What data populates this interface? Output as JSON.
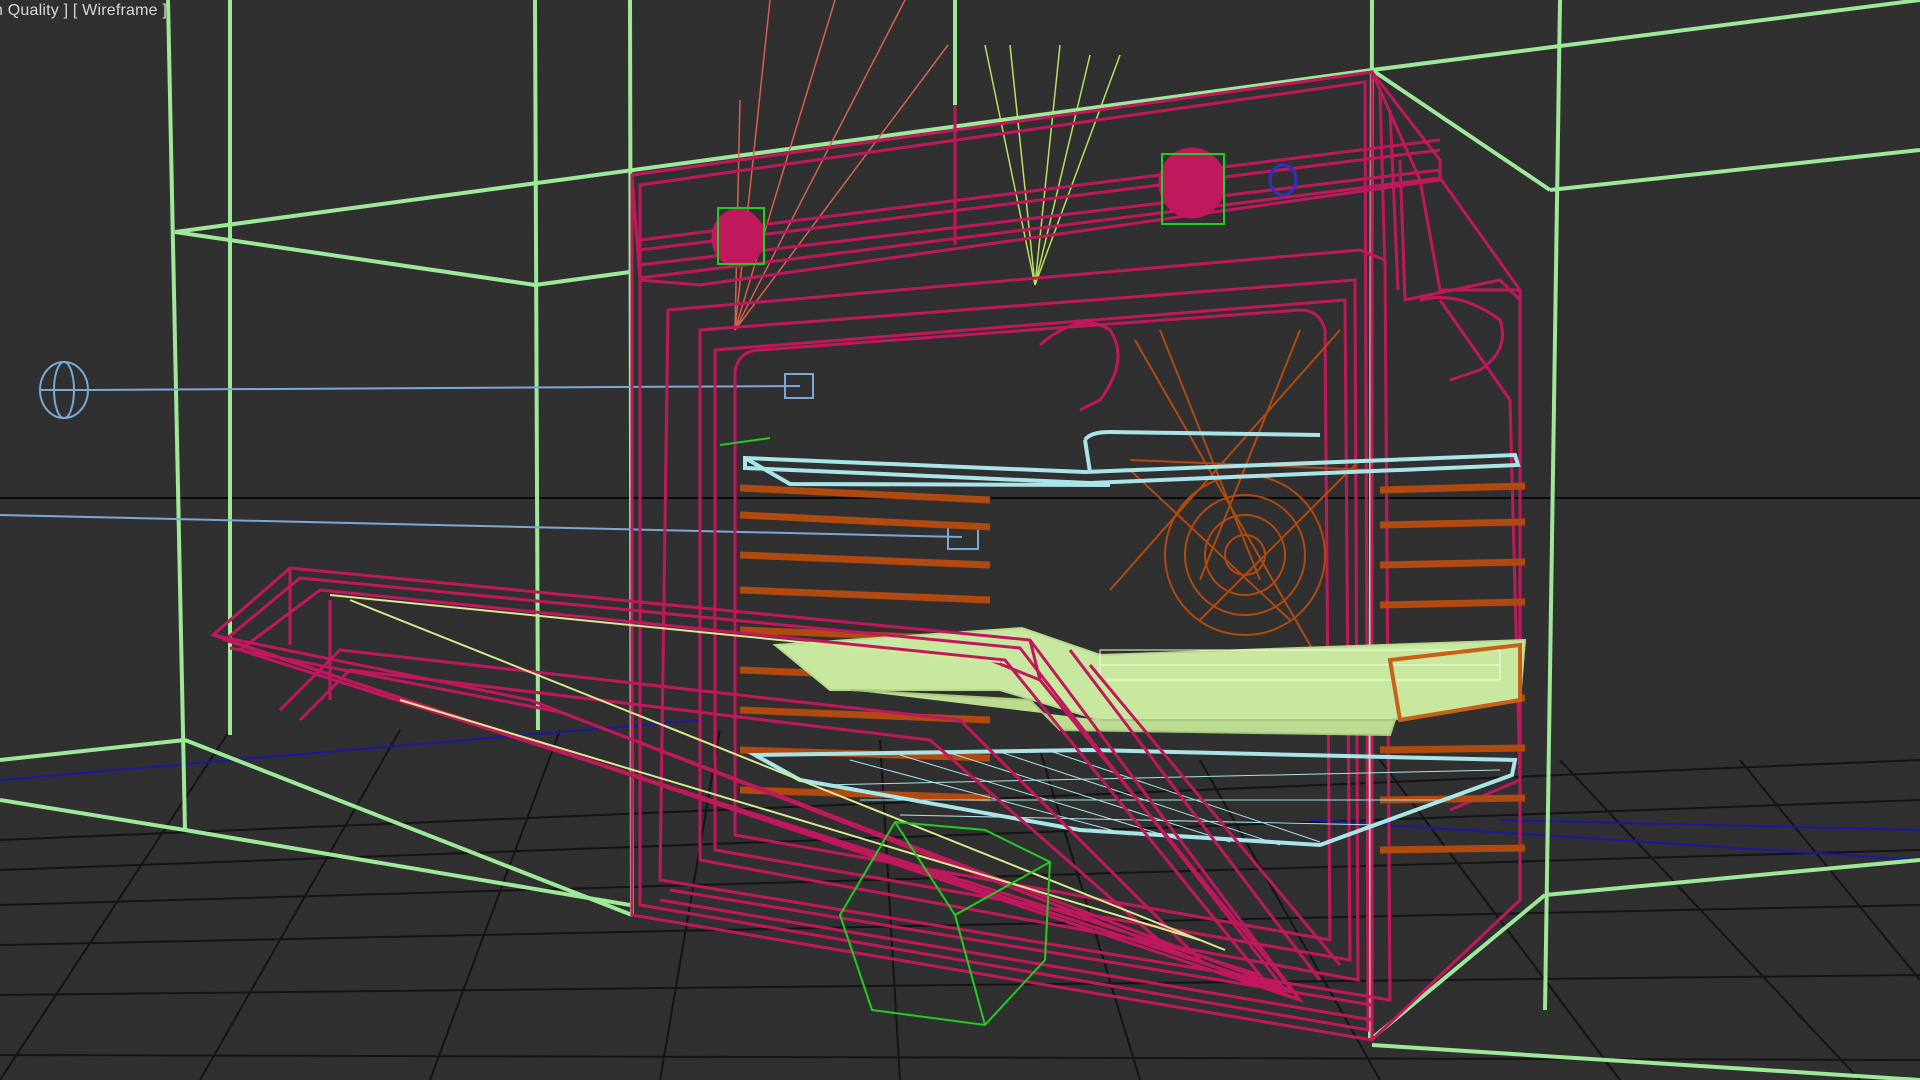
{
  "viewport": {
    "label_quality": "n Quality ]",
    "label_mode": "[ Wireframe ]",
    "shading_mode": "Wireframe"
  },
  "colors": {
    "background": "#303030",
    "grid": "#121212",
    "grid_axis": "#1a1aa0",
    "horizon": "#000000",
    "walls": "#9ee89a",
    "oven_body": "#c0185c",
    "racks": "#a8e4e8",
    "heating_element": "#b04a10",
    "tray": "#c8e8a0",
    "light_helper": "#7aa8d8",
    "camera_helper": "#22cc22",
    "spot_lines": "#d86050",
    "fan_lines": "#b8e060"
  },
  "scene_objects": [
    {
      "name": "kitchen-cabinet",
      "type": "wireframe-box"
    },
    {
      "name": "built-in-oven",
      "type": "mesh"
    },
    {
      "name": "oven-door-open",
      "type": "mesh"
    },
    {
      "name": "baking-tray",
      "type": "mesh"
    },
    {
      "name": "wire-rack-top",
      "type": "mesh"
    },
    {
      "name": "wire-rack-bottom",
      "type": "mesh"
    },
    {
      "name": "convection-fan",
      "type": "mesh"
    },
    {
      "name": "omni-light",
      "type": "light-helper"
    },
    {
      "name": "target-camera",
      "type": "camera-helper"
    }
  ]
}
